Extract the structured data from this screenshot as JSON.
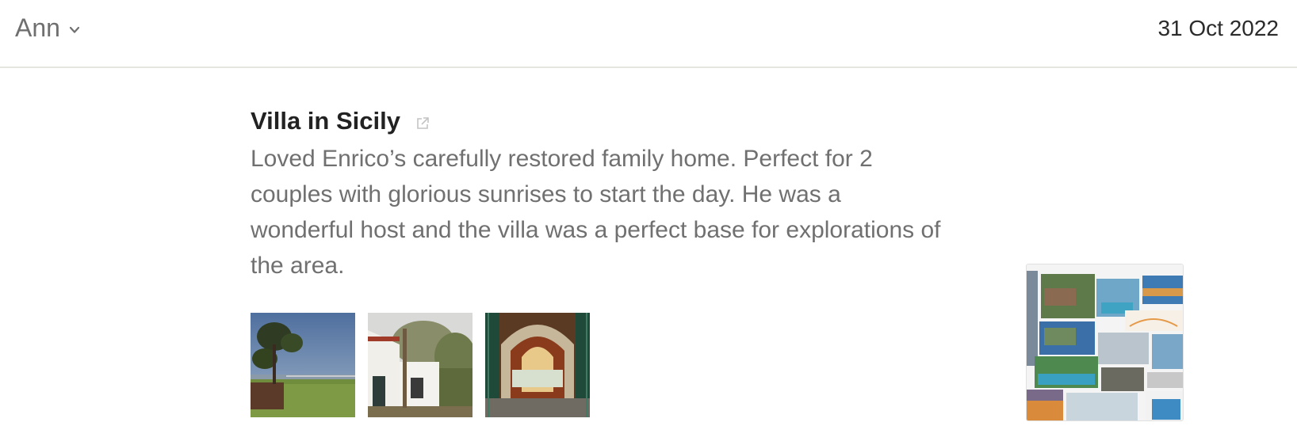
{
  "header": {
    "user_name": "Ann",
    "date": "31 Oct 2022"
  },
  "entry": {
    "title": "Villa in Sicily",
    "description": "Loved Enrico’s carefully restored family home. Perfect for 2 couples with glorious sunrises to start the day. He was a wonderful host and the villa was a perfect base for explorations of the area.",
    "external_link_icon": "external-link-icon",
    "photos": [
      {
        "name": "photo-garden-sea-view"
      },
      {
        "name": "photo-villa-exterior"
      },
      {
        "name": "photo-arched-entrance"
      }
    ],
    "listing_image": {
      "name": "listing-collage-image"
    }
  },
  "colors": {
    "divider": "#e6e6e0",
    "muted_text": "#707070",
    "title_text": "#222222"
  }
}
